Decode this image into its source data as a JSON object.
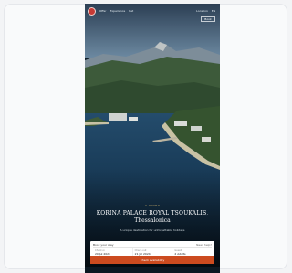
{
  "nav": {
    "links": [
      "Offer",
      "Experience",
      "Eat"
    ],
    "right_links": [
      "Location",
      "EN"
    ],
    "book_label": "Book"
  },
  "hero": {
    "eyebrow": "5 STARS",
    "headline": "KORINA PALACE ROYAL TSOUKALIS,",
    "subline": "Thessalonica",
    "tagline": "A unique destination for unforgettable holidays"
  },
  "booking": {
    "title": "Book your stay",
    "help": "Need help?",
    "fields": [
      {
        "label": "Check-in",
        "value": "20 Jul 2024"
      },
      {
        "label": "Check-out",
        "value": "21 Jul 2024"
      },
      {
        "label": "Guests",
        "value": "2 Adults"
      }
    ],
    "cta": "Check availability"
  },
  "colors": {
    "accent": "#cc4b1f",
    "gold": "#d5b770"
  }
}
